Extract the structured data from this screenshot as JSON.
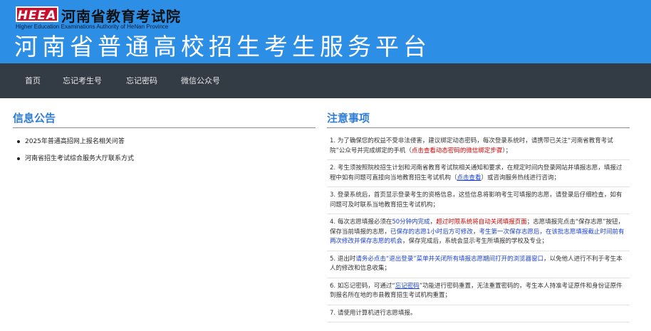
{
  "header": {
    "logo_text": "HEEA",
    "org_name_cn": "河南省教育考试院",
    "org_name_en": "Higher Education Examinations Authority of HeNan Province",
    "platform_title": "河南省普通高校招生考生服务平台"
  },
  "nav": {
    "items": [
      {
        "label": "首页"
      },
      {
        "label": "忘记考生号"
      },
      {
        "label": "忘记密码"
      },
      {
        "label": "微信公众号"
      }
    ]
  },
  "announcements": {
    "title": "信息公告",
    "items": [
      {
        "label": "2025年普通高招网上报名相关问答"
      },
      {
        "label": "河南省招生考试综合服务大厅联系方式"
      }
    ]
  },
  "notes": {
    "title": "注意事项",
    "r1": {
      "num": "1.",
      "a": "为了确保您的权益不受非法侵害，建议绑定动态密码，每次登录系统时，请携带已关注“河南省教育考试院”公众号并完成绑定的手机（",
      "b": "点击查看动态密码的微信绑定步骤",
      "c": "）；"
    },
    "r2": {
      "num": "2.",
      "a": "考生须按照院校招生计划和河南省教育考试院相关通知和要求，在规定时间内登录网站并填报志愿，填报过程中如有问题可直接向当地教育招生考试机构（",
      "b": "点击查看",
      "c": "）或咨询服务热线进行咨询；"
    },
    "r3": {
      "num": "3.",
      "a": "登录系统后，首页显示登录考生的资格信息，这些信息将影响考生可填报的志愿，请登录后仔细检查，如有问题可及时联系当地教育招生考试机构；"
    },
    "r4": {
      "num": "4.",
      "a": "每次志愿填报必须在",
      "b": "50分钟内完成",
      "c": "，",
      "d": "超过时限系统将自动关闭填报页面",
      "e": "；志愿填报完点击“保存志愿”按钮，保存当前填报的志愿，",
      "f": "已保存的志愿1小时后方可修改",
      "g": "，",
      "h": "考生第一次保存志愿后，在该批志愿填报截止时间前有两次修改并保存志愿的机会",
      "i": "，保存完成后，系统会显示考生所填报的学校及专业；"
    },
    "r5": {
      "num": "5.",
      "a": "退出时",
      "b": "请务必点击“退出登录”菜单并关闭所有填报志愿期间打开的浏览器窗口",
      "c": "，以免他人进行不利于考生本人的修改和信息收集；"
    },
    "r6": {
      "num": "6.",
      "a": "如忘记密码，可通过“",
      "b": "忘记密码",
      "c": "”功能进行密码重置，无法重置密码的，考生本人持准考证原件和身份证原件到报名所在地的市县教育招生考试机构重置；"
    },
    "r7": {
      "num": "7.",
      "a": "请使用计算机进行志愿填报。"
    }
  },
  "colors": {
    "header_bg": "#2d8ee6",
    "nav_bg": "#333b44",
    "section_title": "#2f7dd4",
    "emphasis_red": "#d40000",
    "emphasis_blue": "#1a3fd9"
  }
}
